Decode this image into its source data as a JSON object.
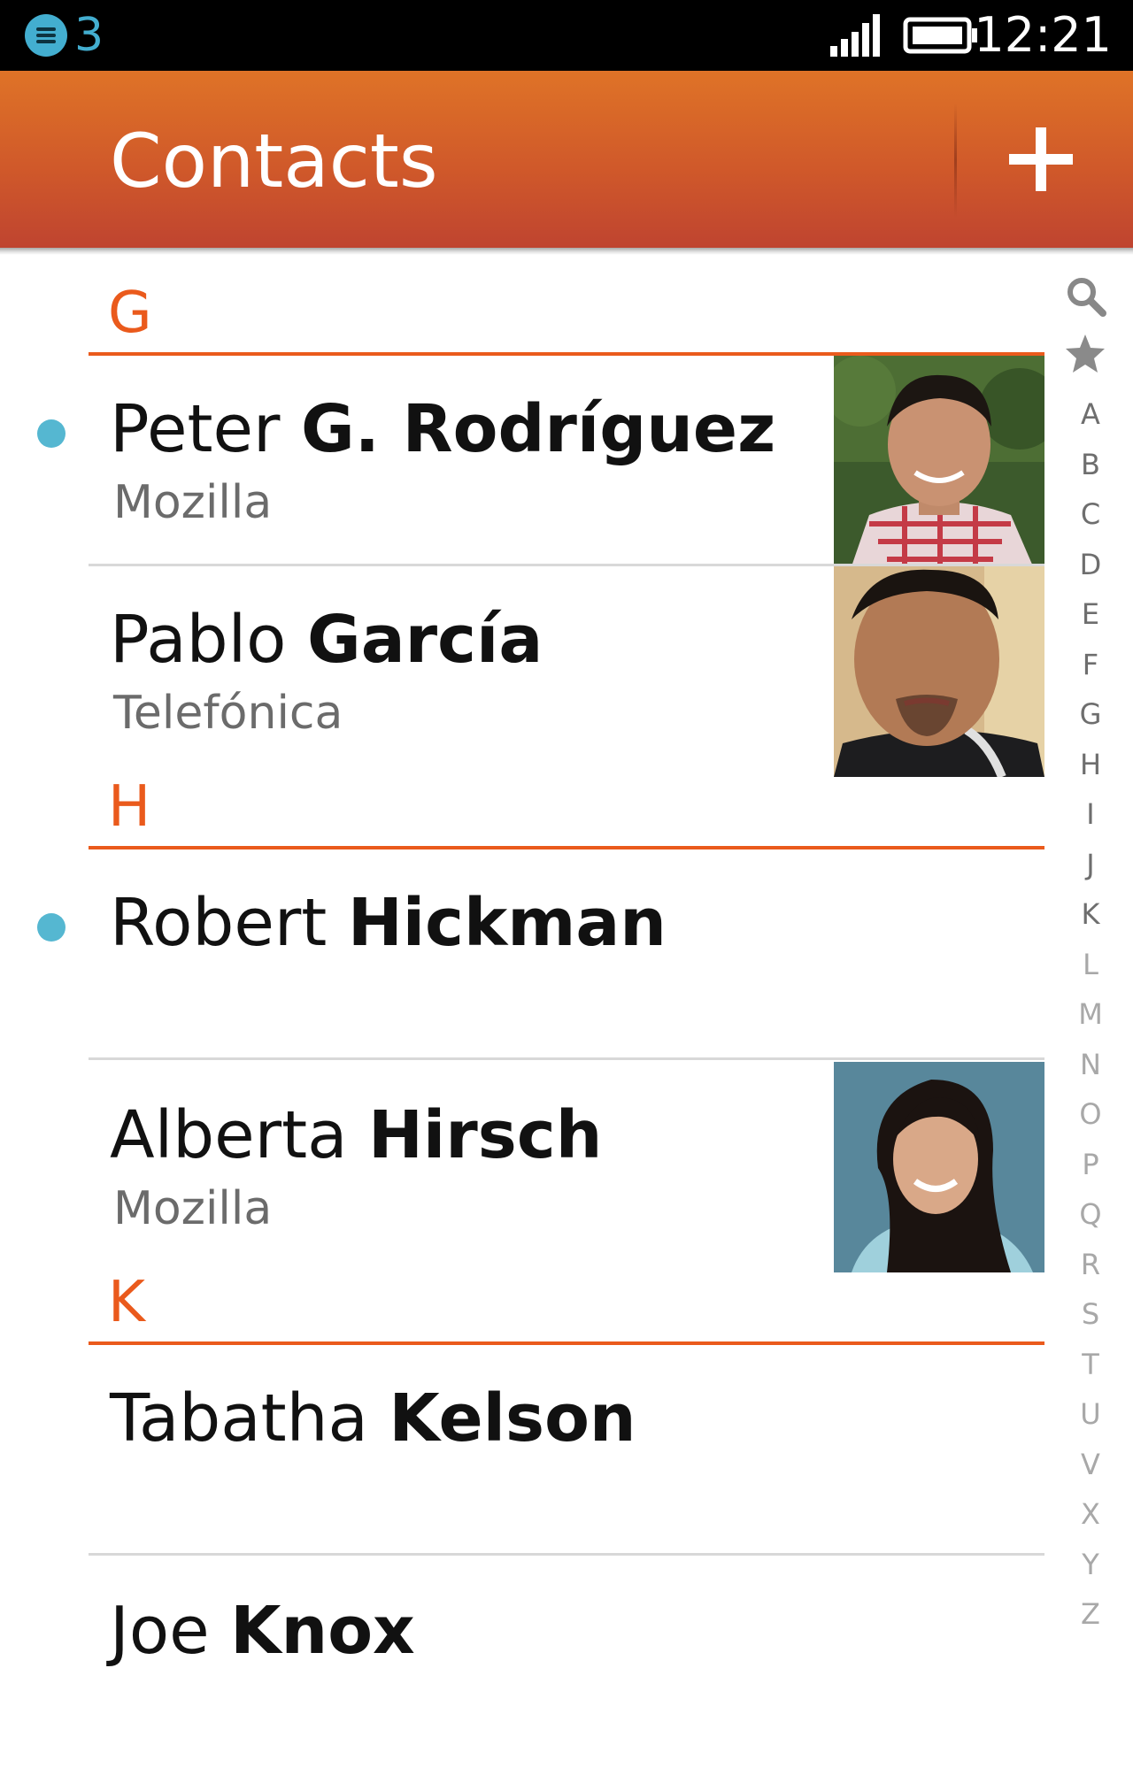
{
  "status_bar": {
    "notification_icon": "notification-list-icon",
    "notification_count": "3",
    "signal_icon": "signal-strength-icon",
    "battery_icon": "battery-icon",
    "time": "12:21"
  },
  "header": {
    "title": "Contacts",
    "add_icon": "plus-icon",
    "accent_color": "#d0592a"
  },
  "sections": [
    {
      "letter": "G"
    },
    {
      "letter": "H"
    },
    {
      "letter": "K"
    }
  ],
  "contacts": [
    {
      "given": "Peter",
      "family": "G. Rodríguez",
      "org": "Mozilla",
      "online": true,
      "photo": "photo-man-plaid-shirt"
    },
    {
      "given": "Pablo",
      "family": "García",
      "org": "Telefónica",
      "online": false,
      "photo": "photo-man-dark-shirt"
    },
    {
      "given": "Robert",
      "family": "Hickman",
      "org": "",
      "online": true,
      "photo": null
    },
    {
      "given": "Alberta",
      "family": "Hirsch",
      "org": "Mozilla",
      "online": false,
      "photo": "photo-woman-smiling"
    },
    {
      "given": "Tabatha",
      "family": "Kelson",
      "org": "",
      "online": false,
      "photo": null
    },
    {
      "given": "Joe",
      "family": "Knox",
      "org": "",
      "online": false,
      "photo": null
    }
  ],
  "alpha_index": {
    "search_icon": "search-icon",
    "favorites_icon": "star-icon",
    "letters": [
      "A",
      "B",
      "C",
      "D",
      "E",
      "F",
      "G",
      "H",
      "I",
      "J",
      "K",
      "L",
      "M",
      "N",
      "O",
      "P",
      "Q",
      "R",
      "S",
      "T",
      "U",
      "V",
      "X",
      "Y",
      "Z"
    ],
    "dark_letters": [
      "A",
      "B",
      "C",
      "D",
      "E",
      "F",
      "G",
      "H",
      "I",
      "J",
      "K"
    ]
  },
  "colors": {
    "section_accent": "#ea5a1c",
    "presence": "#55b7d1",
    "notification": "#43aed0"
  }
}
